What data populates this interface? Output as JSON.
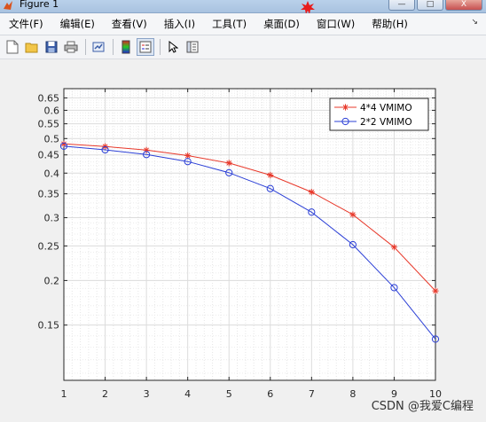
{
  "window": {
    "title": "Figure 1",
    "controls": [
      "—",
      "□",
      "X"
    ]
  },
  "menubar": {
    "items": [
      "文件(F)",
      "编辑(E)",
      "查看(V)",
      "插入(I)",
      "工具(T)",
      "桌面(D)",
      "窗口(W)",
      "帮助(H)"
    ],
    "overflow_icon": "chevron-right-icon"
  },
  "toolbar": {
    "icons": [
      "new-figure-icon",
      "open-file-icon",
      "save-icon",
      "print-icon",
      "link-plot-icon",
      "colorbar-icon",
      "legend-icon",
      "pointer-icon",
      "property-editor-icon"
    ]
  },
  "chart_data": {
    "type": "line",
    "y_scale": "log",
    "xlim": [
      1,
      10
    ],
    "ylim": [
      0.105,
      0.69
    ],
    "x": [
      1,
      2,
      3,
      4,
      5,
      6,
      7,
      8,
      9,
      10
    ],
    "x_ticks": [
      "1",
      "2",
      "3",
      "4",
      "5",
      "6",
      "7",
      "8",
      "9",
      "10"
    ],
    "y_ticks": [
      0.15,
      0.2,
      0.25,
      0.3,
      0.35,
      0.4,
      0.45,
      0.5,
      0.55,
      0.6,
      0.65
    ],
    "y_tick_labels": [
      "0.15",
      "0.2",
      "0.25",
      "0.3",
      "0.35",
      "0.4",
      "0.45",
      "0.5",
      "0.55",
      "0.6",
      "0.65"
    ],
    "grid": true,
    "minor_grid": true,
    "legend_position": "top-right",
    "series": [
      {
        "name": "4*4 VMIMO",
        "color": "#e8392b",
        "marker": "asterisk",
        "values": [
          0.483,
          0.475,
          0.464,
          0.448,
          0.427,
          0.395,
          0.354,
          0.306,
          0.248,
          0.187
        ]
      },
      {
        "name": "2*2 VMIMO",
        "color": "#2b3fd6",
        "marker": "circle",
        "values": [
          0.476,
          0.465,
          0.451,
          0.431,
          0.401,
          0.362,
          0.311,
          0.252,
          0.191,
          0.137
        ]
      }
    ]
  },
  "watermark": "CSDN @我爱C编程"
}
